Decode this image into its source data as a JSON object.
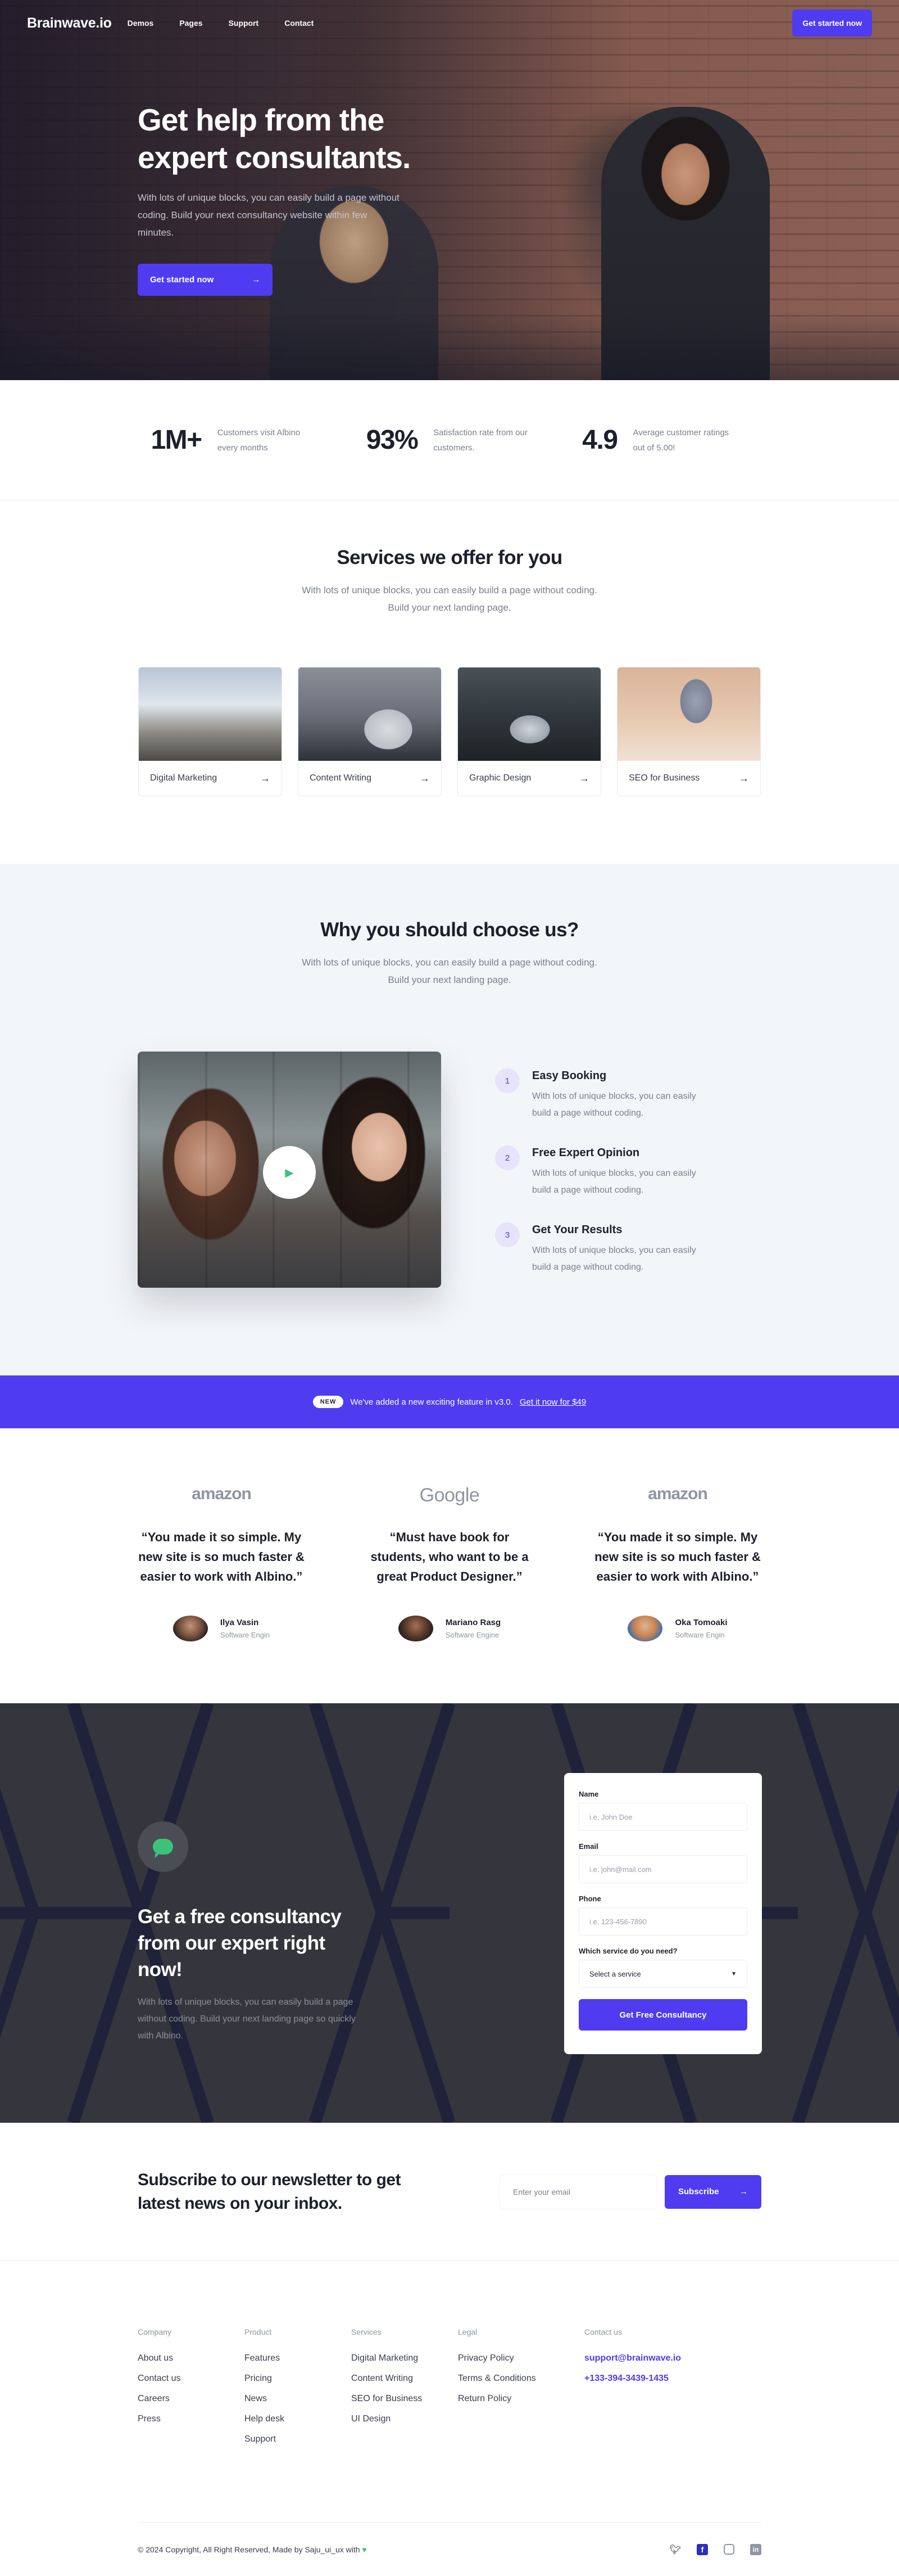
{
  "nav": {
    "logo": "Brainwave.io",
    "links": [
      "Demos",
      "Pages",
      "Support",
      "Contact"
    ],
    "cta": "Get started now"
  },
  "hero": {
    "title": "Get help from the expert consultants.",
    "text": "With lots of unique blocks, you can easily build a page without coding. Build your next consultancy website within few minutes.",
    "button": "Get started now"
  },
  "stats": [
    {
      "value": "1M+",
      "label": "Customers visit Albino every months"
    },
    {
      "value": "93%",
      "label": "Satisfaction rate from our customers."
    },
    {
      "value": "4.9",
      "label": "Average customer ratings out of 5.00!"
    }
  ],
  "services": {
    "title": "Services we offer for you",
    "subtitle": "With lots of unique blocks, you can easily build a page without coding. Build your next landing page.",
    "cards": [
      "Digital Marketing",
      "Content Writing",
      "Graphic Design",
      "SEO for Business"
    ]
  },
  "why": {
    "title": "Why you should choose us?",
    "subtitle": "With lots of unique blocks, you can easily build a page without coding. Build your next landing page.",
    "features": [
      {
        "num": "1",
        "title": "Easy Booking",
        "text": "With lots of unique blocks, you can easily build a page without coding."
      },
      {
        "num": "2",
        "title": "Free Expert Opinion",
        "text": "With lots of unique blocks, you can easily build a page without coding."
      },
      {
        "num": "3",
        "title": "Get Your Results",
        "text": "With lots of unique blocks, you can easily build a page without coding."
      }
    ]
  },
  "banner": {
    "badge": "NEW",
    "text": "We've added a new exciting feature in v3.0.",
    "link": "Get it now for $49"
  },
  "testimonials": [
    {
      "brand": "amazon",
      "quote": "“You made it so simple. My new site is so much faster & easier to work with Albino.”",
      "name": "Ilya Vasin",
      "role": "Software Engin"
    },
    {
      "brand": "Google",
      "quote": "“Must have book for students, who want to be a great Product Designer.”",
      "name": "Mariano Rasg",
      "role": "Software Engine"
    },
    {
      "brand": "amazon",
      "quote": "“You made it so simple. My new site is so much faster & easier to work with Albino.”",
      "name": "Oka Tomoaki",
      "role": "Software Engin"
    }
  ],
  "consult": {
    "title": "Get a free consultancy from our expert right now!",
    "text": "With lots of unique blocks, you can easily build a page without coding. Build your next landing page so quickly with Albino.",
    "form": {
      "name_label": "Name",
      "name_placeholder": "i.e. John Doe",
      "email_label": "Email",
      "email_placeholder": "i.e. john@mail.com",
      "phone_label": "Phone",
      "phone_placeholder": "i.e. 123-456-7890",
      "service_label": "Which service do you need?",
      "service_value": "Select a service",
      "submit": "Get Free Consultancy"
    }
  },
  "newsletter": {
    "title": "Subscribe to our newsletter to get latest news on your inbox.",
    "placeholder": "Enter your email",
    "button": "Subscribe"
  },
  "footer": {
    "columns": [
      {
        "heading": "Company",
        "links": [
          "About us",
          "Contact us",
          "Careers",
          "Press"
        ]
      },
      {
        "heading": "Product",
        "links": [
          "Features",
          "Pricing",
          "News",
          "Help desk",
          "Support"
        ]
      },
      {
        "heading": "Services",
        "links": [
          "Digital Marketing",
          "Content Writing",
          "SEO for Business",
          "UI Design"
        ]
      },
      {
        "heading": "Legal",
        "links": [
          "Privacy Policy",
          "Terms & Conditions",
          "Return Policy"
        ]
      },
      {
        "heading": "Contact us",
        "links": [
          "support@brainwave.io",
          "+133-394-3439-1435"
        ]
      }
    ],
    "copyright": "© 2024 Copyright, All Right Reserved, Made by Saju_ui_ux with",
    "socials": [
      "twitter-icon",
      "facebook-icon",
      "instagram-icon",
      "linkedin-icon"
    ]
  },
  "colors": {
    "accent": "#4f3cf0",
    "green": "#3ec27a",
    "dark": "#35363d"
  }
}
